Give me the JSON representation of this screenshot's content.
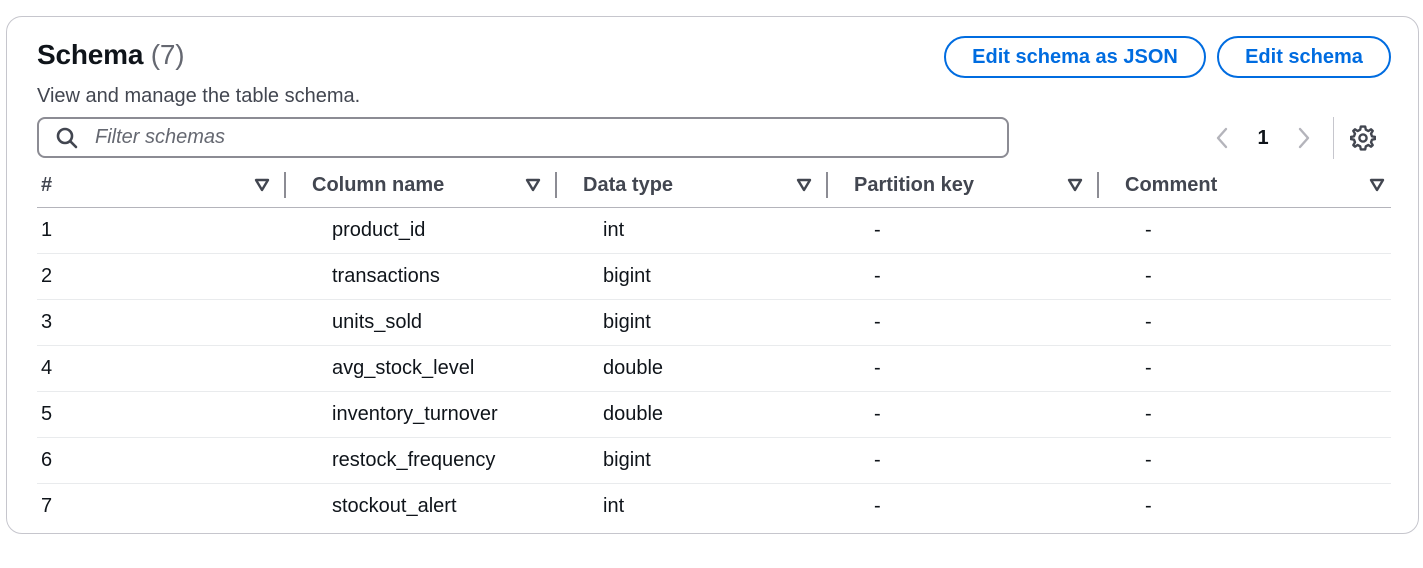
{
  "header": {
    "title": "Schema",
    "count": "(7)",
    "description": "View and manage the table schema.",
    "edit_json_label": "Edit schema as JSON",
    "edit_label": "Edit schema"
  },
  "filter": {
    "placeholder": "Filter schemas",
    "icon": "search-icon"
  },
  "pagination": {
    "current_page": "1",
    "prev_icon": "chevron-left-icon",
    "next_icon": "chevron-right-icon",
    "settings_icon": "gear-icon"
  },
  "table": {
    "columns": [
      "#",
      "Column name",
      "Data type",
      "Partition key",
      "Comment"
    ],
    "rows": [
      [
        "1",
        "product_id",
        "int",
        "-",
        "-"
      ],
      [
        "2",
        "transactions",
        "bigint",
        "-",
        "-"
      ],
      [
        "3",
        "units_sold",
        "bigint",
        "-",
        "-"
      ],
      [
        "4",
        "avg_stock_level",
        "double",
        "-",
        "-"
      ],
      [
        "5",
        "inventory_turnover",
        "double",
        "-",
        "-"
      ],
      [
        "6",
        "restock_frequency",
        "bigint",
        "-",
        "-"
      ],
      [
        "7",
        "stockout_alert",
        "int",
        "-",
        "-"
      ]
    ]
  },
  "colors": {
    "accent": "#006ce0",
    "border": "#c6c6cd"
  }
}
